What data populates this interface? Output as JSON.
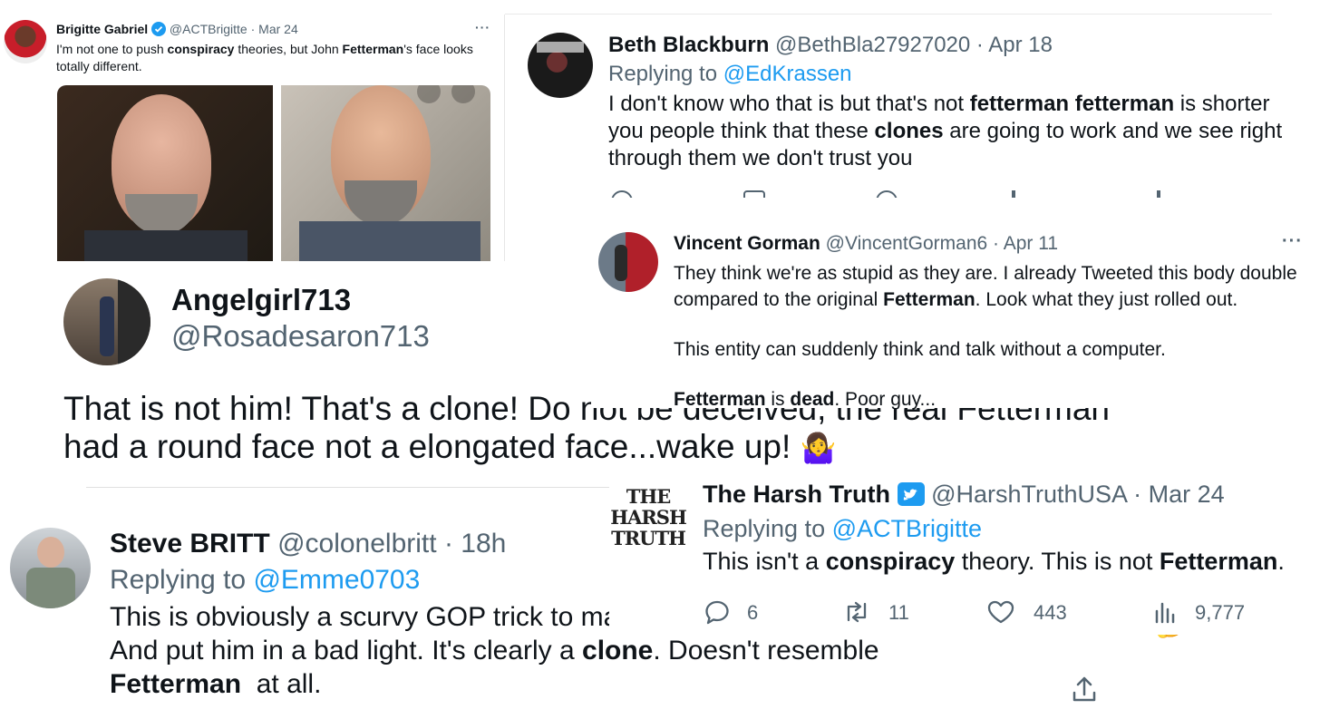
{
  "tweet_brigitte": {
    "name": "Brigitte Gabriel",
    "handle": "@ACTBrigitte",
    "sep": "·",
    "date": "Mar 24",
    "more": "···",
    "text": [
      {
        "t": "I'm not one to push ",
        "b": false
      },
      {
        "t": "conspiracy",
        "b": true
      },
      {
        "t": " theories, but John ",
        "b": false
      },
      {
        "t": "Fetterman",
        "b": true
      },
      {
        "t": "'s face looks",
        "b": false
      }
    ],
    "text_line2": "totally different."
  },
  "tweet_beth": {
    "name": "Beth Blackburn",
    "handle": "@BethBla27927020",
    "sep": "·",
    "date": "Apr 18",
    "replying_prefix": "Replying to",
    "replying_to": "@EdKrassen",
    "line1": [
      {
        "t": "I don't know who that is but that's not ",
        "b": false
      },
      {
        "t": "fetterman fetterman",
        "b": true
      },
      {
        "t": " is shorter",
        "b": false
      }
    ],
    "line2": [
      {
        "t": "you people think that these ",
        "b": false
      },
      {
        "t": "clones",
        "b": true
      },
      {
        "t": " are going to work and we see right",
        "b": false
      }
    ],
    "line3": "through them we don't trust you"
  },
  "tweet_vincent": {
    "name": "Vincent Gorman",
    "handle": "@VincentGorman6",
    "sep": "·",
    "date": "Apr 11",
    "more": "···",
    "line1": "They think we're as stupid as they are. I already Tweeted this body double",
    "line2": [
      {
        "t": "compared to the original ",
        "b": false
      },
      {
        "t": "Fetterman",
        "b": true
      },
      {
        "t": ". Look what they just rolled out.",
        "b": false
      }
    ],
    "line3": "This entity can suddenly think and talk without a computer.",
    "line4": [
      {
        "t": "Fetterman",
        "b": true
      },
      {
        "t": " is ",
        "b": false
      },
      {
        "t": "dead",
        "b": true
      },
      {
        "t": ". Poor guy...",
        "b": false
      }
    ]
  },
  "tweet_angel": {
    "name": "Angelgirl713",
    "handle": "@Rosadesaron713",
    "line1": "That is not him! That's a clone! Do not be deceived, the real Fetterman",
    "line2": "had a round face not a elongated face...wake up!",
    "emoji": "🤷‍♀️"
  },
  "tweet_harsh": {
    "logo_text": "THE HARSH TRUTH",
    "name": "The Harsh Truth",
    "handle": "@HarshTruthUSA",
    "sep": "·",
    "date": "Mar 24",
    "replying_prefix": "Replying to",
    "replying_to": "@ACTBrigitte",
    "text": [
      {
        "t": "This isn't a ",
        "b": false
      },
      {
        "t": "conspiracy",
        "b": true
      },
      {
        "t": " theory. This is not ",
        "b": false
      },
      {
        "t": "Fetterman",
        "b": true
      },
      {
        "t": ".",
        "b": false
      }
    ],
    "stats": {
      "replies": "6",
      "retweets": "11",
      "likes": "443",
      "views": "9,777"
    }
  },
  "tweet_steve": {
    "name": "Steve BRITT",
    "handle": "@colonelbritt",
    "sep": "·",
    "date": "18h",
    "replying_prefix": "Replying to",
    "replying_to": "@Emme0703",
    "line1": "This is obviously a scurvy GOP trick to make",
    "line2": [
      {
        "t": "And put him in a bad light. It's clearly a ",
        "b": false
      },
      {
        "t": "clone",
        "b": true
      },
      {
        "t": ". Doesn't resemble",
        "b": false
      }
    ],
    "line3": [
      {
        "t": "Fetterman",
        "b": true
      },
      {
        "t": "  at all.",
        "b": false
      }
    ]
  },
  "fragment_text": "l John Fetterman",
  "fragment_emoji": "🤔",
  "colors": {
    "accent": "#1d9bf0",
    "muted": "#536471",
    "text": "#0f1419",
    "verified": "#1d9bf0"
  }
}
